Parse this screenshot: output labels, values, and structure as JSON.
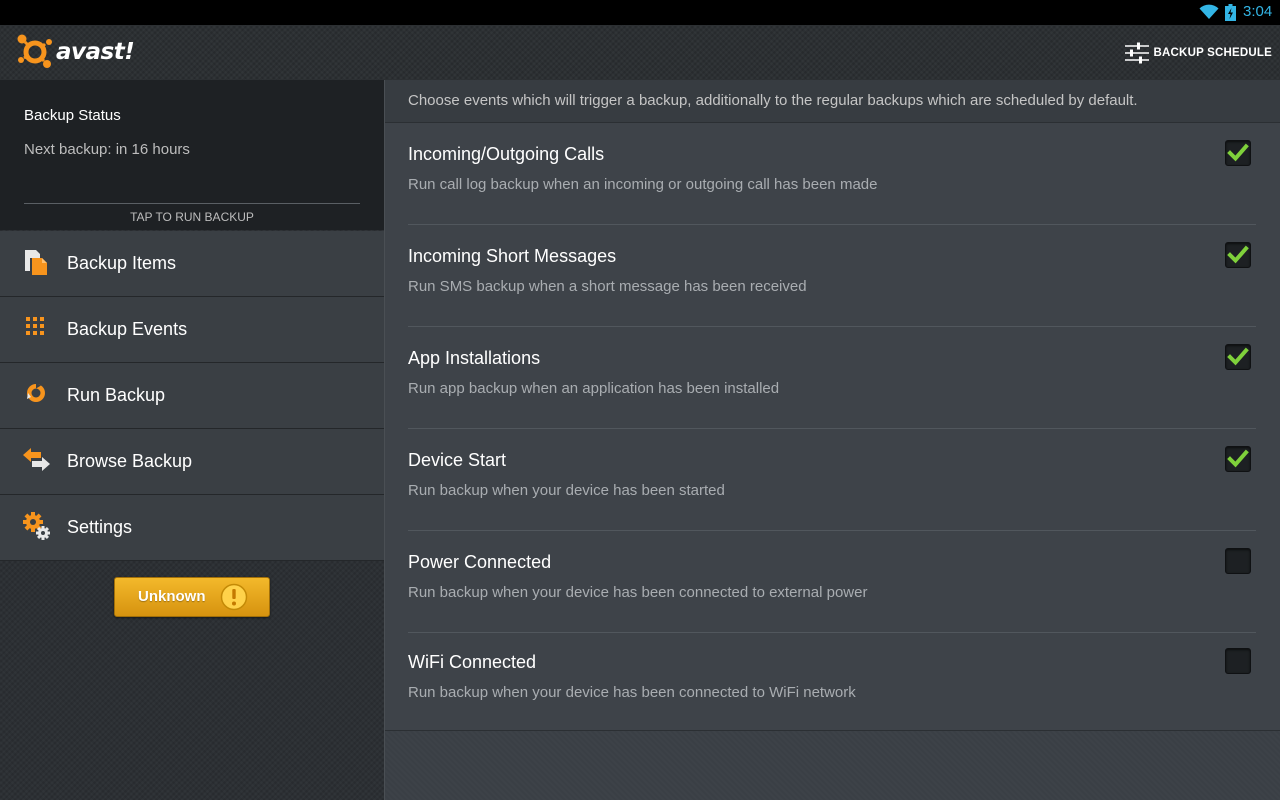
{
  "statusbar": {
    "time": "3:04",
    "icons": [
      "wifi-icon",
      "battery-charging-icon"
    ]
  },
  "actionbar": {
    "app_name": "avast!",
    "schedule_label": "BACKUP SCHEDULE"
  },
  "backup_status": {
    "title": "Backup Status",
    "next": "Next backup: in 16 hours",
    "tap": "TAP TO RUN BACKUP"
  },
  "nav": {
    "items": [
      {
        "label": "Backup Items",
        "icon": "backup-items-icon"
      },
      {
        "label": "Backup Events",
        "icon": "grid-icon"
      },
      {
        "label": "Run Backup",
        "icon": "refresh-icon"
      },
      {
        "label": "Browse Backup",
        "icon": "arrows-icon"
      },
      {
        "label": "Settings",
        "icon": "gears-icon"
      }
    ]
  },
  "unknown_button": {
    "label": "Unknown"
  },
  "intro": "Choose events which will trigger a backup, additionally to the regular backups which are scheduled by default.",
  "events": [
    {
      "title": "Incoming/Outgoing Calls",
      "desc": "Run call log backup when an incoming or outgoing call has been made",
      "checked": true
    },
    {
      "title": "Incoming Short Messages",
      "desc": "Run SMS backup when a short message has been received",
      "checked": true
    },
    {
      "title": "App Installations",
      "desc": "Run app backup when an application has been installed",
      "checked": true
    },
    {
      "title": "Device Start",
      "desc": "Run backup when your device has been started",
      "checked": true
    },
    {
      "title": "Power Connected",
      "desc": "Run backup when your device has been connected to external power",
      "checked": false
    },
    {
      "title": "WiFi Connected",
      "desc": "Run backup when your device has been connected to WiFi network",
      "checked": false
    }
  ],
  "colors": {
    "accent_orange": "#f7941d",
    "check_green": "#7fd13b",
    "clock_blue": "#33b5e5",
    "button_gold": "#e8a81f"
  }
}
